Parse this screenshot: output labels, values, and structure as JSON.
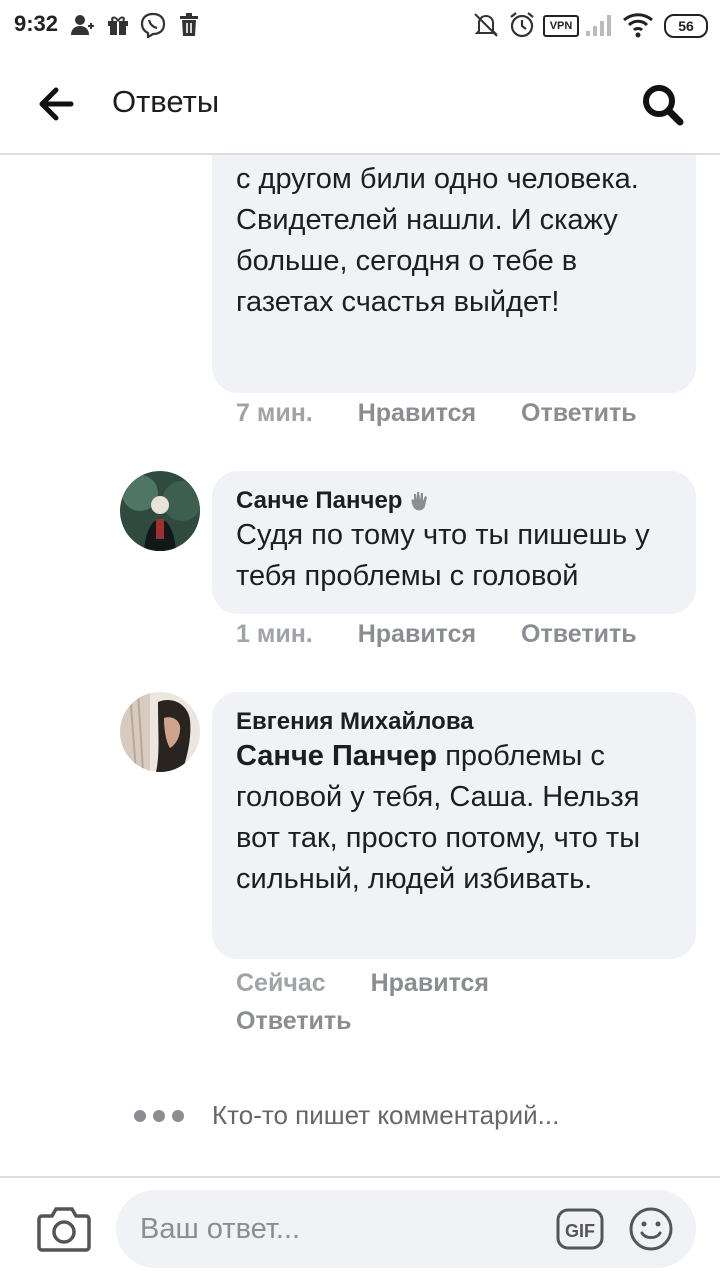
{
  "status_bar": {
    "time": "9:32",
    "vpn_label": "VPN",
    "battery": "56"
  },
  "header": {
    "title": "Ответы"
  },
  "comments": [
    {
      "text": "а потом еще и бьет. И не сам, а с другом били одно человека. Свидетелей нашли. И скажу больше, сегодня о тебе в газетах счастья выйдет!",
      "time": "7 мин.",
      "like_label": "Нравится",
      "reply_label": "Ответить"
    },
    {
      "author": "Санче Панчер",
      "text": "Судя по тому что ты пишешь у тебя проблемы с головой",
      "time": "1 мин.",
      "like_label": "Нравится",
      "reply_label": "Ответить"
    },
    {
      "author": "Евгения Михайлова",
      "mention": "Санче Панчер",
      "text": " проблемы с головой у тебя, Саша. Нельзя вот так, просто потому, что ты сильный, людей избивать.",
      "time": "Сейчас",
      "like_label": "Нравится",
      "reply_label": "Ответить"
    }
  ],
  "typing_indicator": "Кто-то пишет комментарий...",
  "composer": {
    "placeholder": "Ваш ответ...",
    "gif_label": "GIF"
  }
}
